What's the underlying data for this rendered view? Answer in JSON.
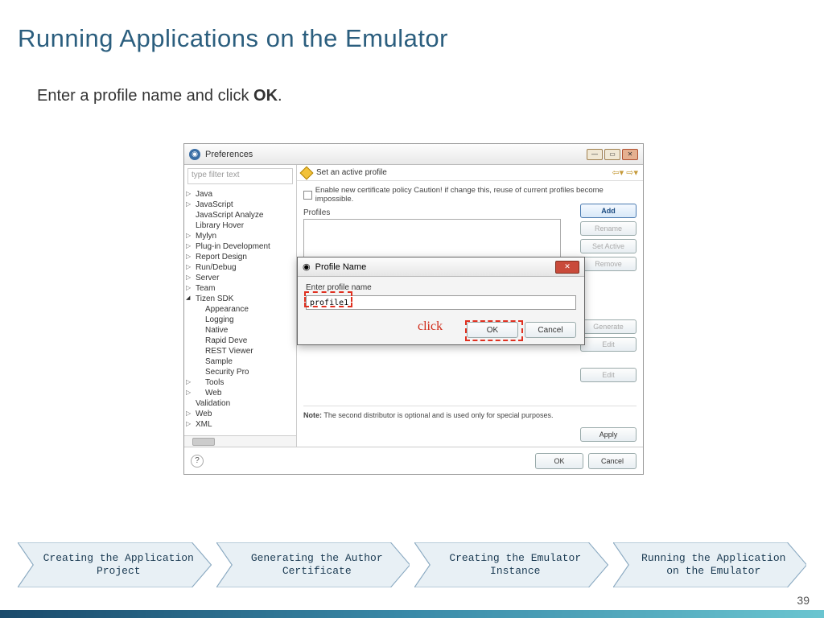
{
  "title": "Running Applications on the Emulator",
  "subtitle_pre": "Enter a profile name and click ",
  "subtitle_bold": "OK",
  "subtitle_post": ".",
  "page_number": "39",
  "click_annotation": "click",
  "process_steps": [
    "Creating the Application Project",
    "Generating the Author Certificate",
    "Creating the Emulator Instance",
    "Running the Application on the Emulator"
  ],
  "pref_window": {
    "title": "Preferences",
    "filter_placeholder": "type filter text",
    "tree": [
      "Java",
      "JavaScript",
      "JavaScript Analyze",
      "Library Hover",
      "Mylyn",
      "Plug-in Development",
      "Report Design",
      "Run/Debug",
      "Server",
      "Team",
      "Tizen SDK",
      "Appearance",
      "Logging",
      "Native",
      "Rapid Deve",
      "REST Viewer",
      "Sample",
      "Security Pro",
      "Tools",
      "Web",
      "Validation",
      "Web",
      "XML"
    ],
    "warn_text": "Set an active profile",
    "checkbox_text": "Enable new certificate policy Caution! if change this, reuse of current profiles become impossible.",
    "profiles_label": "Profiles",
    "buttons": {
      "add": "Add",
      "rename": "Rename",
      "set_active": "Set Active",
      "remove": "Remove",
      "generate": "Generate",
      "edit": "Edit",
      "apply": "Apply",
      "ok": "OK",
      "cancel": "Cancel"
    },
    "note_label": "Note:",
    "note_text": " The second distributor is optional and is used only for special purposes.",
    "help": "?"
  },
  "pn_dialog": {
    "title": "Profile Name",
    "label": "Enter profile name",
    "value": "profile1",
    "ok": "OK",
    "cancel": "Cancel"
  }
}
